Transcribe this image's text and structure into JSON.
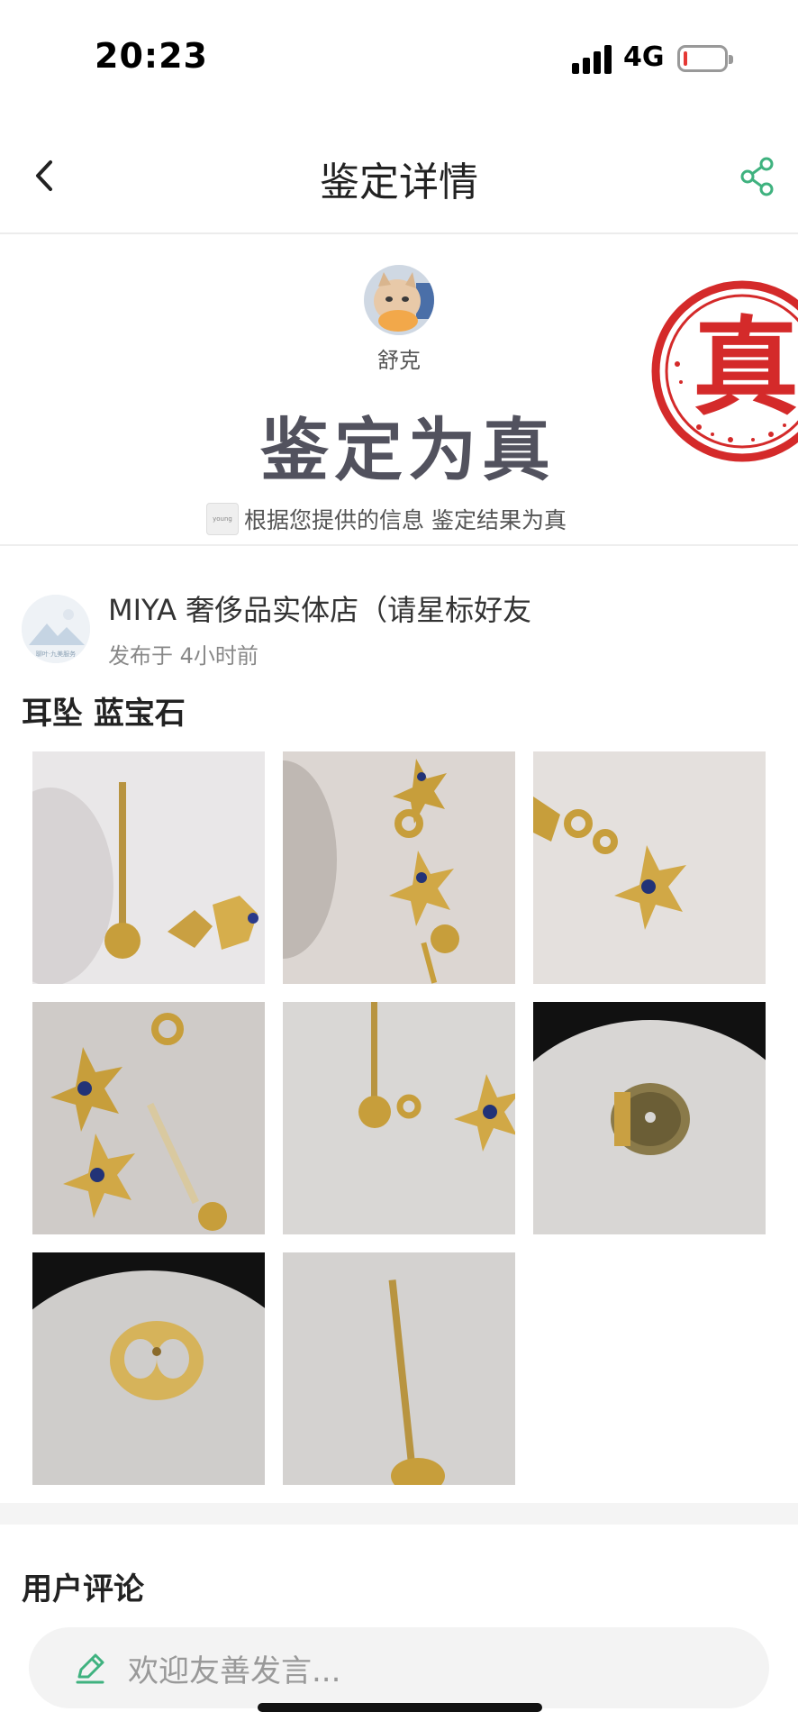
{
  "status_bar": {
    "time": "20:23",
    "network": "4G",
    "battery_level": 0.1
  },
  "nav": {
    "title": "鉴定详情",
    "back_icon": "chevron-left-icon",
    "share_icon": "share-icon"
  },
  "result": {
    "appraiser_name": "舒克",
    "verdict": "鉴定为真",
    "seal_text": "真",
    "brand_logo_text": "young",
    "info_text": "根据您提供的信息 鉴定结果为真"
  },
  "post": {
    "poster_name": "MIYA 奢侈品实体店（请星标好友",
    "poster_avatar_caption": "聊叶·九美服务",
    "post_time": "发布于 4小时前",
    "title": "耳坠 蓝宝石",
    "photos": [
      "earring-post-photo",
      "cross-chain-photo",
      "cross-pendant-photo",
      "pair-earrings-photo",
      "post-and-cross-photo",
      "earring-back-dark-photo",
      "earring-back-gold-photo",
      "post-closeup-photo"
    ]
  },
  "comments": {
    "title": "用户评论",
    "placeholder": "欢迎友善发言..."
  },
  "colors": {
    "accent_green": "#3fb27f",
    "seal_red": "#d42a2a",
    "verdict_gray": "#52525e"
  }
}
